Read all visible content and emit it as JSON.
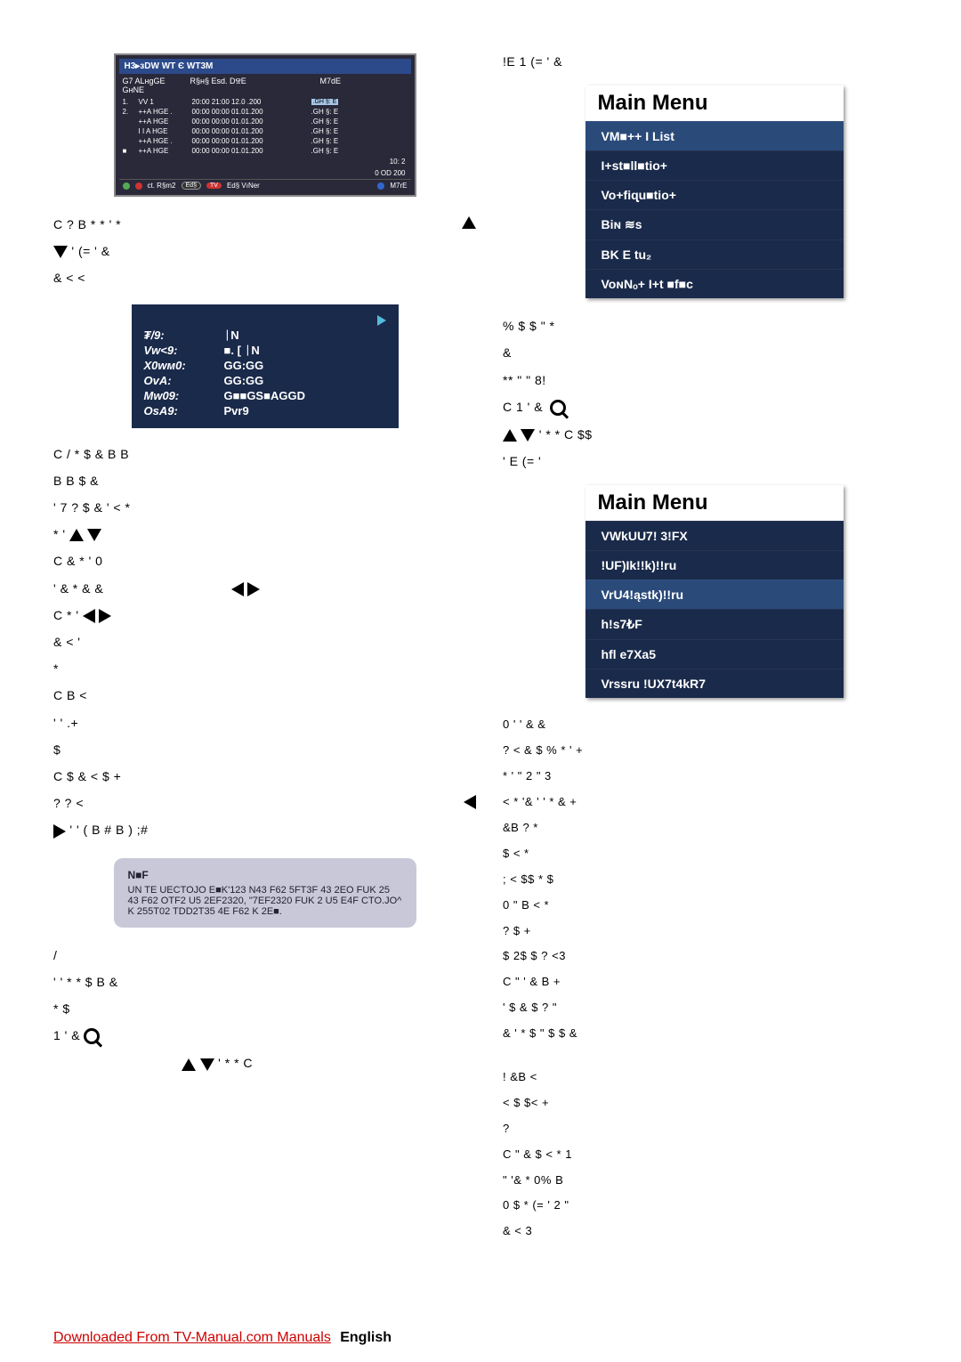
{
  "left": {
    "timer": {
      "title": "H3▸зDW WT Є WT3M",
      "cols": [
        "G7 ALнgGE GнNE",
        "R§н§   Esd.   DⰔE",
        "M7dE"
      ],
      "rows": [
        {
          "n": "1.",
          "ch": "VV 1",
          "t": "20:00  21:00  12.0 .200",
          "m": ".GH §: E",
          "hi": true
        },
        {
          "n": "2.",
          "ch": "++A HGE .",
          "t": "00:00  00:00  01.01.200",
          "m": ".GH §: E"
        },
        {
          "n": "",
          "ch": "++A HGE",
          "t": "00:00  00:00  01.01.200",
          "m": ".GH §: E"
        },
        {
          "n": "",
          "ch": "I I A HGE",
          "t": "00:00  00:00  01.01.200",
          "m": ".GH §: E"
        },
        {
          "n": "",
          "ch": "++A HGE .",
          "t": "00:00  00:00  01.01.200",
          "m": ".GH §: E"
        },
        {
          "n": "■",
          "ch": "++A HGE",
          "t": "00:00  00:00  01.01.200",
          "m": ".GH §: E"
        }
      ],
      "time": "10: 2",
      "date": "0    OD 200",
      "ctrl": [
        "ct. R§m2",
        "Ed§",
        "Ed§ VıNer",
        "M7rE"
      ]
    },
    "para1_a": "C         ?  B  *   *        '       *",
    "para1_b": "   '                       (=   '              &",
    "para1_c": "    &  <    <",
    "settings": {
      "rows": [
        {
          "l": "₮/9:",
          "v": "ᛁN"
        },
        {
          "l": "Vw<9:",
          "v": "■. [ ᛁN"
        },
        {
          "l": "X0wм0:",
          "v": "GG:GG"
        },
        {
          "l": "OvA:",
          "v": "GG:GG"
        },
        {
          "l": "Mw09:",
          "v": "G■■GS■AGGD"
        },
        {
          "l": "OsA9:",
          "v": "Pvr9"
        }
      ]
    },
    "p2": "C        /    *  $      &  B         B",
    "p2b": "        B       B       $     &",
    "p2c": "  '      7      ?  $   &  '  <         *",
    "p2d": "    *             '",
    "p3": "C          &        *                      '        0",
    "p3b": "      '       &  *   &          &",
    "p4": "C               *                      '",
    "p4b": "       &               <       '",
    "p4c": "     *",
    "p5": "C        B                     <",
    "p5b": "     '  '                         .+",
    "p5c": "  $",
    "p6": "C    $     &            <  $        +",
    "p6b": "    ?             ?           <",
    "p6c": "      '       '           (       B  #  B    )  ;#",
    "note_t": "N■F",
    "note_b": "UN TE UECTOJO E■K'123 N43 F62 5FT3F 43 2EO FUK 25 43 F62 OTF2 U5 2EF2320, \"7EF2320 FUK 2 U5 E4F CTO.JO^ K 255T02 TDD2T35 4E F62 K 2E■.",
    "pB1": "      /",
    "pB2": "  '   '   *    *    $      B  &",
    "pB3": "     *                          $",
    "pB4": "          1                     '          &",
    "pB5": "                             '   *   *         C"
  },
  "right": {
    "top": "!E      1       (=    '             &",
    "menu1_title": "Main Menu",
    "menu1": [
      "VM■++ I List",
      "I+st■ll■tio+",
      "Vo+fiɋu■tio+",
      "Biɴ  ≋s",
      "BK E  tu₂",
      "VoɴNₒ+ I+t  ■f■c"
    ],
    "r1": "%        $         $                    \"    *",
    "r1b": "      &",
    "r1c": "  **  \"  \"    8!",
    "r2": "C 1          '              &",
    "r2b": "            '         *   *              C  $$",
    "r2c": "   '     E                       (=    '",
    "menu2_title": "Main Menu",
    "menu2": [
      "VWkUU7! 3!FX",
      "!UF)Ik!!k)!!ru",
      "VrU4!ąstk)!!ru",
      "h!s7₺F",
      "hﬂ e7Xa5",
      "Vrssru !UX7t4kR7"
    ],
    "r3": "0             '    '         &           &",
    "r3b": "   ?  <    &       $   %  *         '   +",
    "r3c": "     *   '           \"            2  \"  3",
    "r3d": "      <  *     '&   '   '   *      &    +",
    "r3e": "     &B                   ?          *",
    "r3f": "   $    <  *",
    "r4": ";   <    $$           *  $",
    "r4b": "  0       \"  B      <  *",
    "r4c": "                       ?         $  +",
    "r4d": "     $       2$    $    ?  <3",
    "r5": "C     \"      '     &       B        +",
    "r5b": "    '        $  &  $  ?        \"",
    "r5c": "       &  '    *   $    \"    $   $  &",
    "r6": "!                         &B  <",
    "r6b": "    <   $  $<                       +",
    "r6c": "   ?",
    "r7": "C    \"   &      $  <  *     1",
    "r7b": "      \"  '&     *   0%     B",
    "r7c": "  0  $        *         (=   '   2  \"",
    "r7d": "       &  <              3"
  },
  "footer_link": "Downloaded From TV-Manual.com Manuals",
  "footer_lang": "English"
}
